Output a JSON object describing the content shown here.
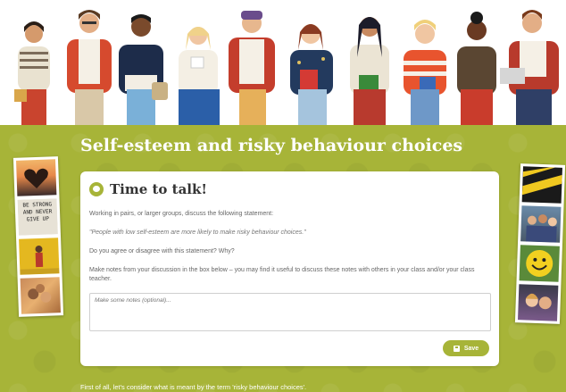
{
  "page": {
    "title": "Self-esteem and risky behaviour choices"
  },
  "card": {
    "heading": "Time to talk!",
    "intro": "Working in pairs, or larger groups, discuss the following statement:",
    "statement": "\"People with low self-esteem are more likely to make risky behaviour choices.\"",
    "question": "Do you agree or disagree with this statement? Why?",
    "instructions": "Make notes from your discussion in the box below – you may find it useful to discuss these notes with others in your class and/or your class teacher.",
    "notes_placeholder": "Make some notes (optional)...",
    "save_label": "Save"
  },
  "photos": {
    "left": [
      "heart-hands-photo",
      "be-strong-sign-photo",
      "person-yellow-wall-photo",
      "hands-together-photo"
    ],
    "right": [
      "caution-tape-photo",
      "group-people-photo",
      "smiley-ball-photo",
      "friends-selfie-photo"
    ],
    "sign_text": "BE STRONG AND NEVER GIVE UP"
  },
  "footer": {
    "text": "First of all, let's consider what is meant by the term 'risky behaviour choices'."
  },
  "colors": {
    "brand_green": "#a7b438",
    "card_bg": "#ffffff"
  }
}
